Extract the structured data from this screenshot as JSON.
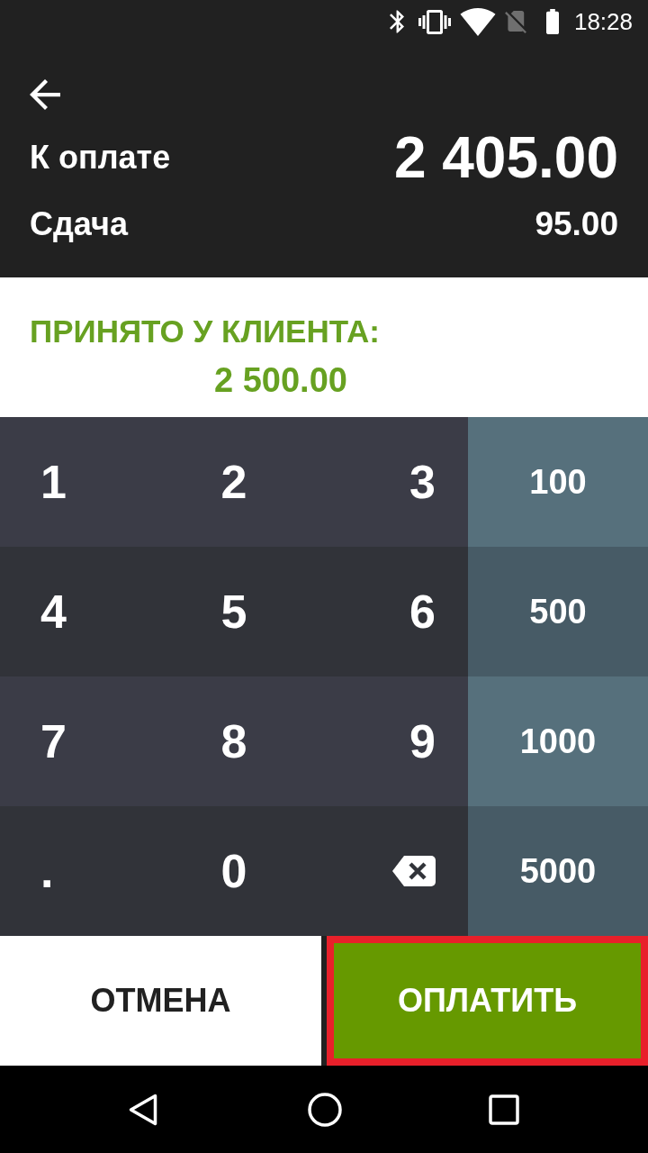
{
  "status_bar": {
    "time": "18:28"
  },
  "header": {
    "rows": [
      {
        "kind": "total",
        "label": "К оплате",
        "value": "2 405.00"
      },
      {
        "kind": "change",
        "label": "Сдача",
        "value": "95.00"
      }
    ]
  },
  "received": {
    "label": "ПРИНЯТО У КЛИЕНТА:",
    "value": "2 500.00"
  },
  "keypad": {
    "rows": [
      {
        "keys": [
          {
            "kind": "digit",
            "label": "1"
          },
          {
            "kind": "digit",
            "label": "2"
          },
          {
            "kind": "digit",
            "label": "3"
          }
        ],
        "amount": "100"
      },
      {
        "keys": [
          {
            "kind": "digit",
            "label": "4"
          },
          {
            "kind": "digit",
            "label": "5"
          },
          {
            "kind": "digit",
            "label": "6"
          }
        ],
        "amount": "500"
      },
      {
        "keys": [
          {
            "kind": "digit",
            "label": "7"
          },
          {
            "kind": "digit",
            "label": "8"
          },
          {
            "kind": "digit",
            "label": "9"
          }
        ],
        "amount": "1000"
      },
      {
        "keys": [
          {
            "kind": "point",
            "label": "."
          },
          {
            "kind": "digit",
            "label": "0"
          },
          {
            "kind": "backspace"
          }
        ],
        "amount": "5000"
      }
    ]
  },
  "actions": [
    {
      "kind": "cancel",
      "label": "ОТМЕНА",
      "highlighted": false
    },
    {
      "kind": "pay",
      "label": "ОПЛАТИТЬ",
      "highlighted": true
    }
  ]
}
